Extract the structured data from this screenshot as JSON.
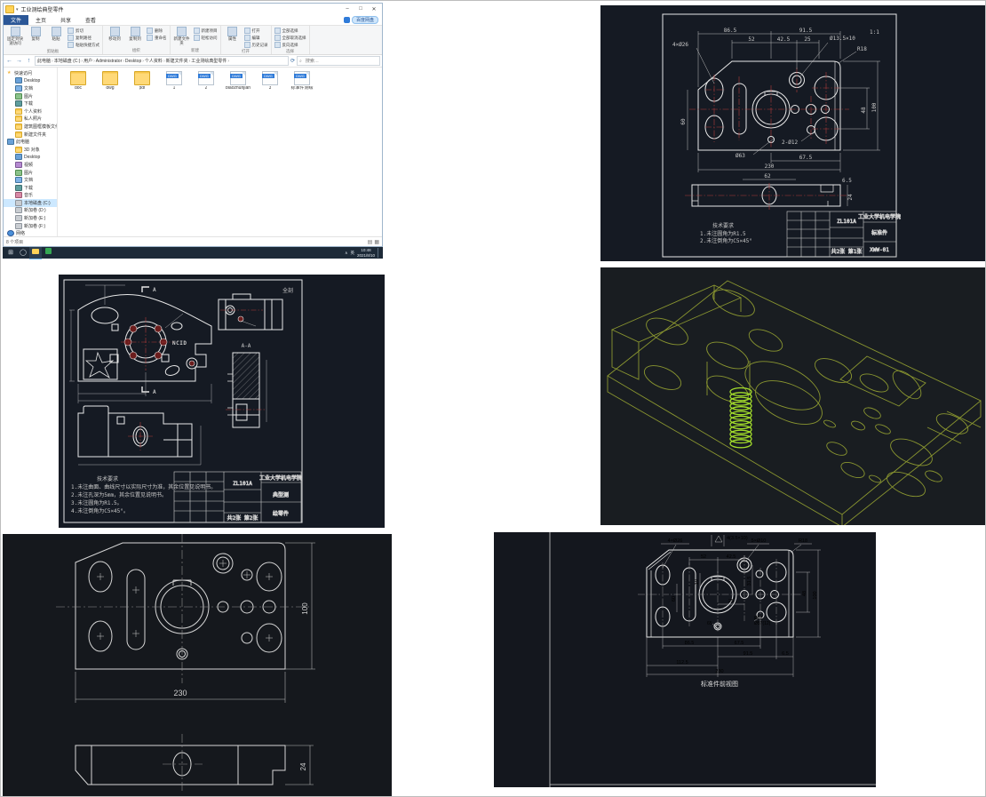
{
  "colors": {
    "cad_background": "#151a23",
    "cad_background_3d": "#191d21",
    "cad_line": "#e8e8e8",
    "cad_centerline_red": "#b23b3b",
    "cad_dim_gray": "#c9c9c9",
    "wireframe_olive": "#8a9630",
    "spring_green": "#a4df2b",
    "explorer_accent_blue": "#2b5797",
    "taskbar": "#1d2a38",
    "selection": "#cce8ff"
  },
  "explorer": {
    "title": "工业测绘典型零件",
    "quick_access_toolbar": "▾",
    "window_controls": {
      "minimize": "–",
      "maximize": "□",
      "close": "✕"
    },
    "tabs": [
      {
        "label": "文件",
        "accent": true
      },
      {
        "label": "主页",
        "selected": true
      },
      {
        "label": "共享"
      },
      {
        "label": "查看"
      }
    ],
    "netdisk_label": "百度网盘",
    "ribbon": {
      "groups": [
        {
          "label": "剪贴板",
          "big1": "固定到快速访问",
          "big2": "复制",
          "big3": "粘贴",
          "small1": "剪切",
          "small2": "复制路径",
          "small3": "粘贴快捷方式"
        },
        {
          "label": "组织",
          "big1": "移动到",
          "big2": "复制到",
          "small1": "删除",
          "small2": "重命名"
        },
        {
          "label": "新建",
          "big1": "新建文件夹",
          "small1": "新建项目",
          "small2": "轻松访问"
        },
        {
          "label": "打开",
          "big1": "属性",
          "small1": "打开",
          "small2": "编辑",
          "small3": "历史记录"
        },
        {
          "label": "选择",
          "small1": "全部选择",
          "small2": "全部取消选择",
          "small3": "反向选择"
        }
      ]
    },
    "nav": {
      "back": "←",
      "forward": "→",
      "up": "↑",
      "refresh": "⟳",
      "dropdown": "▾"
    },
    "breadcrumb": [
      "此电脑",
      "本地磁盘 (C:)",
      "用户",
      "Administrator",
      "Desktop",
      "个人资料",
      "新建文件夹",
      "工业测绘典型零件"
    ],
    "search_placeholder": "搜索…",
    "sidebar": [
      {
        "label": "快速访问",
        "icon": "star",
        "level": 0
      },
      {
        "label": "Desktop",
        "icon": "desktop",
        "level": 1
      },
      {
        "label": "文档",
        "icon": "doc",
        "level": 1
      },
      {
        "label": "图片",
        "icon": "pic",
        "level": 1
      },
      {
        "label": "下载",
        "icon": "down",
        "level": 1
      },
      {
        "label": "个人资料",
        "icon": "folder",
        "level": 1
      },
      {
        "label": "私人照片",
        "icon": "folder",
        "level": 1
      },
      {
        "label": "建筑图框模板文件",
        "icon": "folder",
        "level": 1
      },
      {
        "label": "新建文件夹",
        "icon": "folder",
        "level": 1
      },
      {
        "label": "此电脑",
        "icon": "pc",
        "level": 0
      },
      {
        "label": "3D 对象",
        "icon": "folder",
        "level": 1
      },
      {
        "label": "Desktop",
        "icon": "desktop",
        "level": 1
      },
      {
        "label": "视频",
        "icon": "video",
        "level": 1
      },
      {
        "label": "图片",
        "icon": "pic",
        "level": 1
      },
      {
        "label": "文档",
        "icon": "doc",
        "level": 1
      },
      {
        "label": "下载",
        "icon": "down",
        "level": 1
      },
      {
        "label": "音乐",
        "icon": "music",
        "level": 1
      },
      {
        "label": "本地磁盘 (C:)",
        "icon": "disk",
        "level": 1,
        "selected": true
      },
      {
        "label": "新加卷 (D:)",
        "icon": "disk",
        "level": 1
      },
      {
        "label": "新加卷 (E:)",
        "icon": "disk",
        "level": 1
      },
      {
        "label": "新加卷 (F:)",
        "icon": "disk",
        "level": 1
      },
      {
        "label": "网络",
        "icon": "net",
        "level": 0
      }
    ],
    "files": [
      {
        "name": "doc",
        "type": "folder"
      },
      {
        "name": "dwg",
        "type": "folder"
      },
      {
        "name": "pdf",
        "type": "folder"
      },
      {
        "name": "1",
        "type": "dwg"
      },
      {
        "name": "2",
        "type": "dwg"
      },
      {
        "name": "biaozhunjian",
        "type": "dwg"
      },
      {
        "name": "3",
        "type": "dwg"
      },
      {
        "name": "标准件测绘",
        "type": "dwg"
      }
    ],
    "status": "8 个项目"
  },
  "taskbar": {
    "ime": "英",
    "time": "10:48",
    "date": "2021/8/10",
    "tray_arrow": "∧"
  },
  "cad1": {
    "code": "ZL101A",
    "org": "工业大学机电学院",
    "part": "标准件",
    "number": "XWW-01",
    "sheet": "共2张 第1张",
    "scale_note": "1:1",
    "notes_title": "技术要求",
    "note1": "1.未注圆角为R1.5",
    "note2": "2.未注倒角为C5×45°",
    "dims": {
      "d865": "86.5",
      "d915": "91.5",
      "d52": "52",
      "d425": "42.5",
      "d25": "25",
      "hole4": "4×Ø26",
      "cs": "Ø13.5×10",
      "r18": "R18",
      "d60": "60",
      "d48": "48",
      "d100": "100",
      "d675": "67.5",
      "d230": "230",
      "dia63": "Ø63",
      "d212": "2-Ø12",
      "d62": "62",
      "d65": "6.5",
      "d24": "24"
    }
  },
  "cad2": {
    "code": "ZL101A",
    "org": "工业大学机电学院",
    "part_line1": "典型测",
    "part_line2": "绘零件",
    "sheet": "共2张 第2张",
    "section_label": "A-A",
    "corner_note": "全剖",
    "logo": "NCID",
    "mark_top": "A",
    "mark_bottom": "A",
    "notes_title": "技术要求",
    "note1": "1.未注曲面、曲线尺寸以实际尺寸为准，其余位置见说明书。",
    "note2": "2.未注孔深为5mm，其余位置见说明书。",
    "note3": "3.未注圆角为R1.5。",
    "note4": "4.未注倒角为C5×45°。"
  },
  "cad4": {
    "dims": {
      "d230": "230",
      "d100": "100",
      "d24": "24"
    }
  },
  "cad5": {
    "caption": "标准件前视图",
    "labels": {
      "hole4": "4×Ø26",
      "finish": "4(3.5×10)",
      "hole5": "5×Ø10",
      "r18": "R18"
    },
    "dims": {
      "d52": "52",
      "d425": "42.5",
      "d19": "19",
      "d60": "60",
      "d25": "25",
      "d315": "31.5",
      "d48": "48",
      "d100": "100",
      "dia63": "Ø63",
      "dia57": "Ø57(12)",
      "d65": "65",
      "d865": "86.5",
      "d675": "67.5",
      "d915": "91.5",
      "d65b": "6.5",
      "d1125": "112.5",
      "d230": "230"
    }
  }
}
